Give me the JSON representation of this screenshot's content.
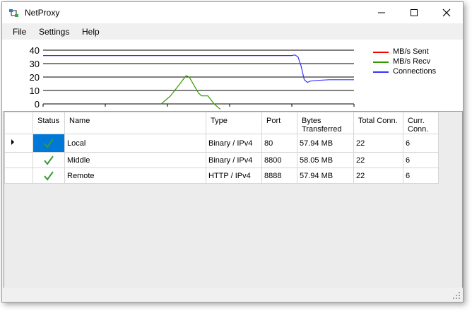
{
  "window": {
    "title": "NetProxy"
  },
  "menu": {
    "items": [
      {
        "label": "File"
      },
      {
        "label": "Settings"
      },
      {
        "label": "Help"
      }
    ]
  },
  "colors": {
    "sent": "#ff0000",
    "recv": "#339900",
    "connections": "#3333ff"
  },
  "chart_data": {
    "type": "line",
    "yticks": [
      "40",
      "30",
      "20",
      "10",
      "0"
    ],
    "ylim": [
      0,
      40
    ],
    "xlim": [
      0,
      100
    ],
    "grid": true,
    "legend_position": "right",
    "series": [
      {
        "name": "MB/s Sent",
        "color": "#ff0000",
        "x": [],
        "y": []
      },
      {
        "name": "MB/s Recv",
        "color": "#339900",
        "x": [
          38,
          41,
          43,
          45,
          46,
          47,
          48,
          49,
          50,
          51,
          53,
          54,
          55,
          56,
          57
        ],
        "y": [
          0,
          6,
          12,
          18,
          21,
          20,
          16,
          12,
          8,
          6,
          6,
          3,
          0,
          -2,
          -4
        ]
      },
      {
        "name": "Connections",
        "color": "#3333ff",
        "x": [
          0,
          20,
          40,
          60,
          80,
          81,
          82,
          83,
          84,
          85,
          86,
          88,
          92,
          100
        ],
        "y": [
          36,
          36,
          36,
          36,
          36,
          36.5,
          35,
          28,
          18,
          16,
          17,
          17.5,
          18,
          18
        ]
      }
    ]
  },
  "grid": {
    "columns": [
      "Status",
      "Name",
      "Type",
      "Port",
      "Bytes Transferred",
      "Total Conn.",
      "Curr. Conn."
    ],
    "rows": [
      {
        "selected": true,
        "status": "ok",
        "name": "Local",
        "type": "Binary / IPv4",
        "port": "80",
        "bytes": "57.94 MB",
        "total": "22",
        "curr": "6"
      },
      {
        "selected": false,
        "status": "ok",
        "name": "Middle",
        "type": "Binary / IPv4",
        "port": "8800",
        "bytes": "58.05 MB",
        "total": "22",
        "curr": "6"
      },
      {
        "selected": false,
        "status": "ok",
        "name": "Remote",
        "type": "HTTP / IPv4",
        "port": "8888",
        "bytes": "57.94 MB",
        "total": "22",
        "curr": "6"
      }
    ]
  }
}
